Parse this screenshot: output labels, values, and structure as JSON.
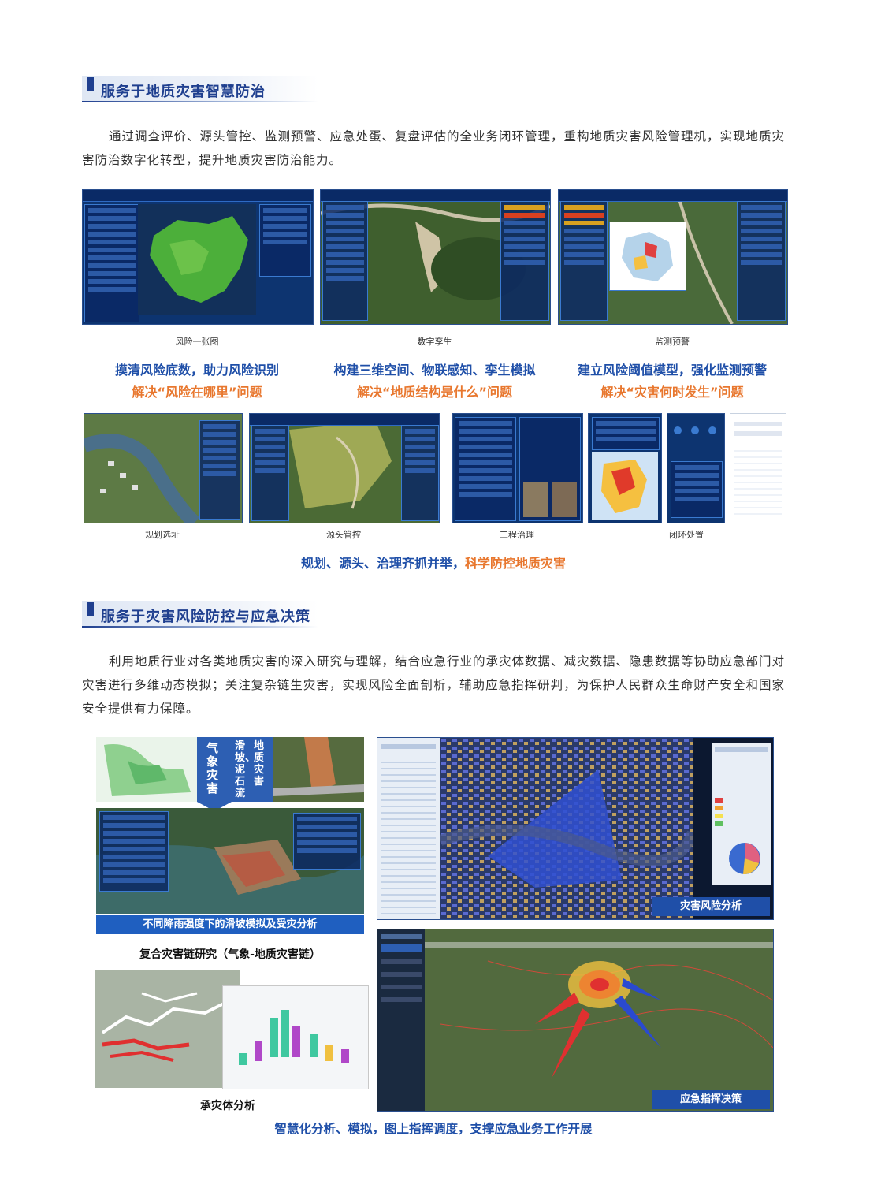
{
  "section1": {
    "heading": "服务于地质灾害智慧防治",
    "paragraph": "通过调查评价、源头管控、监测预警、应急处蛋、复盘评估的全业务闭环管理，重构地质灾害风险管理机，实现地质灾害防治数字化转型，提升地质灾害防治能力。",
    "row1_captions": [
      "风险一张图",
      "数字孪生",
      "监测预警"
    ],
    "row1_titles": [
      "摸清风险底数，助力风险识别",
      "构建三维空间、物联感知、孪生模拟",
      "建立风险阈值模型，强化监测预警"
    ],
    "row1_subtitles": [
      "解决“风险在哪里”问题",
      "解决“地质结构是什么”问题",
      "解决“灾害何时发生”问题"
    ],
    "row2_captions": [
      "规划选址",
      "源头管控",
      "工程治理",
      "闭环处置"
    ],
    "row2_summary_blue": "规划、源头、治理齐抓并举，",
    "row2_summary_orange": "科学防控地质灾害"
  },
  "section2": {
    "heading": "服务于灾害风险防控与应急决策",
    "paragraph": "利用地质行业对各类地质灾害的深入研究与理解，结合应急行业的承灾体数据、减灾数据、隐患数据等协助应急部门对灾害进行多维动态模拟；关注复杂链生灾害，实现风险全面剖析，辅助应急指挥研判，为保护人民群众生命财产安全和国家安全提供有力保障。",
    "tag_weather": "气象灾害",
    "tag_geo": "地质灾害",
    "tag_geo2": "滑坡、泥石流",
    "landslide_banner": "不同降雨强度下的滑坡模拟及受灾分析",
    "chain_caption": "复合灾害链研究（气象-地质灾害链）",
    "exposure_caption": "承灾体分析",
    "risk_caption": "灾害风险分析",
    "command_caption": "应急指挥决策",
    "bottom_summary": "智慧化分析、模拟，图上指挥调度，支撑应急业务工作开展"
  },
  "colors": {
    "brand_blue": "#1f3f8f",
    "title_blue": "#1f4fa8",
    "accent_orange": "#e8772e"
  }
}
